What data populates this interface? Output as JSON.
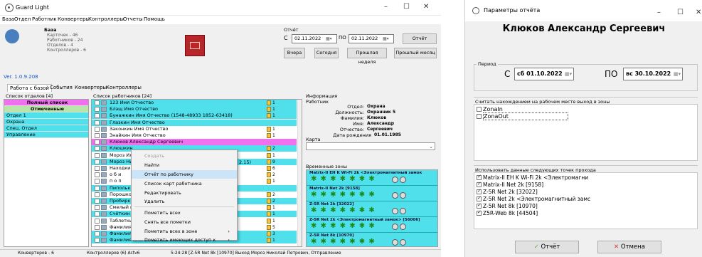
{
  "main": {
    "app_title": "Guard Light",
    "menu": [
      "База",
      "Отдел",
      "Работник",
      "Конвертеры",
      "Контроллеры",
      "Отчеты",
      "Помощь"
    ],
    "db_header": "База",
    "db_stats": [
      "Карточек - 46",
      "Работников - 24",
      "Отделов - 4",
      "Контроллеров - 6"
    ],
    "version": "Ver. 1.0.9.208",
    "report": {
      "label": "Отчёт",
      "from_label": "С",
      "from_value": "02.11.2022",
      "to_label": "ПО",
      "to_value": "02.11.2022",
      "report_button": "Отчёт",
      "quick": [
        "Вчера",
        "Сегодня",
        "Прошлая неделя",
        "Прошлый месяц"
      ]
    },
    "tabs": [
      "Работа с базой",
      "События",
      "Конвертеры",
      "Контроллеры"
    ],
    "dept_list_header": "Список отделов [4]",
    "depts": [
      "Полный список",
      "Отмеченные",
      "Отдел 1",
      "Охрана",
      "Спец. Отдел",
      "Управление"
    ],
    "emp_list_header": "Список работников [24]",
    "employees": [
      {
        "name": "123 Имя Отчество",
        "num": "1"
      },
      {
        "name": "Блэщ Имя Отчество",
        "num": "1"
      },
      {
        "name": "Бунажкин Имя Отчество (1548-48933 1852-63418)",
        "num": "1"
      },
      {
        "name": "Глазкин Имя Отчество",
        "num": ""
      },
      {
        "name": "Законкин Имя Отчество",
        "num": "1"
      },
      {
        "name": "Знайкин Имя Отчество",
        "num": "1"
      },
      {
        "name": "Клюков Александр Сергеевич",
        "num": ""
      },
      {
        "name": "Клюшкин",
        "num": "2"
      },
      {
        "name": "Мороз Ил",
        "num": "1"
      },
      {
        "name": "Мороз Ни",
        "num": "9"
      },
      {
        "name": "Находкин",
        "num": "6"
      },
      {
        "name": "о б и",
        "num": "2"
      },
      {
        "name": "п о п",
        "num": "1"
      },
      {
        "name": "Пипольк",
        "num": ""
      },
      {
        "name": "Порошко",
        "num": "2"
      },
      {
        "name": "Пробирк",
        "num": "2"
      },
      {
        "name": "Смелый и",
        "num": "1"
      },
      {
        "name": "Счёткин",
        "num": "1"
      },
      {
        "name": "Таблетки",
        "num": "1"
      },
      {
        "name": "Фамилия Имя Отчество",
        "num": "5"
      },
      {
        "name": "Фамилия Имя Отчество",
        "num": "3"
      },
      {
        "name": "Фамилия Имя Отчество",
        "num": "1"
      }
    ],
    "emp_extra_fragment": "2.15)",
    "context_menu": [
      {
        "label": "Создать",
        "disabled": true,
        "highlight": false,
        "submenu": false
      },
      {
        "label": "Найти",
        "disabled": false,
        "highlight": false,
        "submenu": false
      },
      {
        "label": "Отчёт по работнику",
        "disabled": false,
        "highlight": true,
        "submenu": false
      },
      {
        "label": "Список карт работника",
        "disabled": false,
        "highlight": false,
        "submenu": false
      },
      {
        "label": "Редактировать",
        "disabled": false,
        "highlight": false,
        "submenu": false
      },
      {
        "label": "Удалить",
        "disabled": false,
        "highlight": false,
        "submenu": false
      },
      {
        "label": "Пометить всех",
        "disabled": false,
        "highlight": false,
        "submenu": false
      },
      {
        "label": "Снять все пометки",
        "disabled": false,
        "highlight": false,
        "submenu": false
      },
      {
        "label": "Пометить всех в зоне",
        "disabled": false,
        "highlight": false,
        "submenu": true
      },
      {
        "label": "Пометить имеющих доступ к",
        "disabled": false,
        "highlight": false,
        "submenu": true
      }
    ],
    "info": {
      "header": "Информация",
      "worker_label": "Работник",
      "fields": [
        {
          "label": "Отдел:",
          "value": "Охрана"
        },
        {
          "label": "Должность:",
          "value": "Охранник 5"
        },
        {
          "label": "Фамилия:",
          "value": "Клюков"
        },
        {
          "label": "Имя:",
          "value": "Александр"
        },
        {
          "label": "Отчество:",
          "value": "Сергеевич"
        },
        {
          "label": "Дата рождения",
          "value": "01.01.1985"
        }
      ],
      "card_label": "Карта",
      "zones_label": "Временные зоны",
      "zones": [
        "Matrix-II EH K Wi-Fi 2k <Электромагнитный замок",
        "Matrix-II Net 2k [9158]",
        "Z-5R Net 2k [32022]",
        "Z-5R Net 2k <Электромагнитный замок> [56006]",
        "Z-5R Net 8k [10970]"
      ]
    },
    "status": [
      "Конвертеров - 6",
      "Контроллеров (6) Actv6",
      "5:24:28 [Z-5R Net 8k [10970] Выход Мороз Николай Петрович, Отправление"
    ]
  },
  "dialog": {
    "title": "Параметры отчёта",
    "employee": "Клюков Александр Сергеевич",
    "period_label": "Период",
    "from_label": "С",
    "from_value": "сб 01.10.2022",
    "to_label": "ПО",
    "to_value": "вс 30.10.2022",
    "exit_zones_label": "Считать нахождением на рабочем месте выход в зоны",
    "zones": [
      "ZonaIn",
      "ZonaOut"
    ],
    "points_label": "Использовать данные следующих точек прохода",
    "points": [
      "Matrix-II EH K Wi-Fi 2k <Электромагни",
      "Matrix-II Net 2k [9158]",
      "Z-5R Net 2k [32022]",
      "Z-5R Net 2k <Электромагнитный замс",
      "Z-5R Net 8k [10970]",
      "Z5R-Web 8k [44504]"
    ],
    "ok_button": "Отчёт",
    "cancel_button": "Отмена"
  }
}
